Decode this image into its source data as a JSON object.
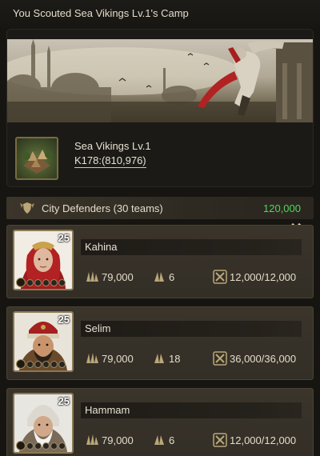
{
  "header": {
    "title": "You Scouted Sea Vikings Lv.1's Camp"
  },
  "target": {
    "name": "Sea Vikings Lv.1",
    "coords": "K178:(810,976)"
  },
  "section": {
    "title": "City Defenders (30 teams)",
    "power": "120,000",
    "power_color": "#4fd65a"
  },
  "defenders": [
    {
      "name": "Kahina",
      "level": "25",
      "troops": "79,000",
      "count": "6",
      "hp": "12,000/12,000"
    },
    {
      "name": "Selim",
      "level": "25",
      "troops": "79,000",
      "count": "18",
      "hp": "36,000/36,000"
    },
    {
      "name": "Hammam",
      "level": "25",
      "troops": "79,000",
      "count": "6",
      "hp": "12,000/12,000"
    }
  ],
  "icons": {
    "section": "shield-wings-icon",
    "troops": "troops-icon",
    "count": "formation-icon",
    "hp": "crossed-swords-icon",
    "expand": "double-chevron-right-icon"
  }
}
